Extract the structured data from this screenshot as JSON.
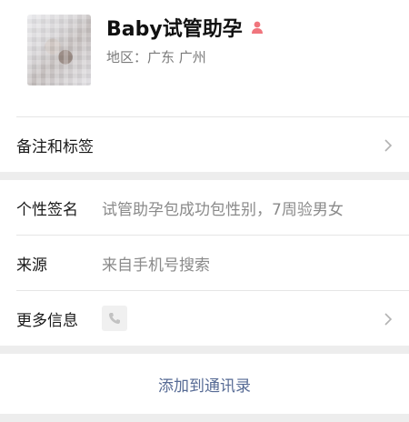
{
  "profile": {
    "name": "Baby试管助孕",
    "region": "地区：广东 广州"
  },
  "remark_row": {
    "label": "备注和标签"
  },
  "signature_row": {
    "label": "个性签名",
    "value": "试管助孕包成功包性别，7周验男女"
  },
  "source_row": {
    "label": "来源",
    "value": "来自手机号搜索"
  },
  "more_row": {
    "label": "更多信息"
  },
  "action": {
    "label": "添加到通讯录"
  },
  "colors": {
    "link": "#576b95",
    "gender_icon": "#f0757d",
    "background": "#ededed"
  },
  "icons": [
    "gender-female-icon",
    "chevron-right-icon",
    "phone-icon"
  ]
}
